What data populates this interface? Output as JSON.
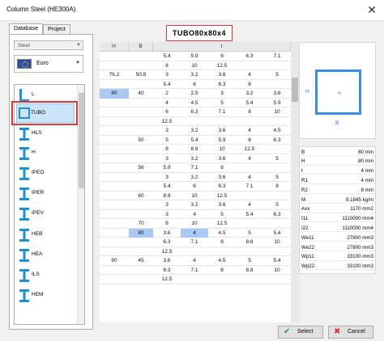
{
  "window": {
    "title": "Column Steel (HE300A)"
  },
  "tabs": [
    "Database",
    "Project"
  ],
  "material_combo": "Steel",
  "standard_combo": "Euro",
  "sections": [
    {
      "label": "L",
      "icon": "angle-section-icon"
    },
    {
      "label": "TUBO",
      "icon": "square-tube-icon"
    },
    {
      "label": "HLS",
      "icon": "i-beam-icon"
    },
    {
      "label": "H",
      "icon": "i-beam-icon"
    },
    {
      "label": "IPEO",
      "icon": "i-beam-icon"
    },
    {
      "label": "IPER",
      "icon": "i-beam-icon"
    },
    {
      "label": "IPEV",
      "icon": "i-beam-icon"
    },
    {
      "label": "HEB",
      "icon": "i-beam-icon"
    },
    {
      "label": "HEA",
      "icon": "i-beam-icon"
    },
    {
      "label": "ILS",
      "icon": "i-beam-icon"
    },
    {
      "label": "HEM",
      "icon": "i-beam-icon"
    }
  ],
  "selected_section": "TUBO",
  "profile_name": "TUBO80x80x4",
  "grid": {
    "columns": [
      "H",
      "B",
      "t"
    ],
    "h_col": [
      "",
      "",
      "76.2",
      "",
      "80",
      "",
      "",
      "",
      "",
      "",
      "",
      "",
      "",
      "",
      "",
      "",
      "",
      "",
      "",
      "",
      "",
      "",
      "90",
      "",
      ""
    ],
    "b_col": [
      "",
      "",
      "50.8",
      "",
      "40",
      "",
      "",
      "",
      "",
      "50",
      "",
      "",
      "56",
      "",
      "",
      "60",
      "",
      "",
      "70",
      "80",
      "",
      "",
      "45",
      "",
      ""
    ],
    "t_col": [
      [
        "5.4",
        "5.9",
        "6",
        "6.3",
        "7.1"
      ],
      [
        "8",
        "10",
        "12.5",
        "",
        ""
      ],
      [
        "3",
        "3.2",
        "3.6",
        "4",
        "5"
      ],
      [
        "5.4",
        "6",
        "6.3",
        "8",
        ""
      ],
      [
        "2",
        "2.5",
        "3",
        "3.2",
        "3.6"
      ],
      [
        "4",
        "4.5",
        "5",
        "5.4",
        "5.9"
      ],
      [
        "6",
        "6.3",
        "7.1",
        "8",
        "10"
      ],
      [
        "12.5",
        "",
        "",
        "",
        ""
      ],
      [
        "3",
        "3.2",
        "3.6",
        "4",
        "4.5"
      ],
      [
        "5",
        "5.4",
        "5.9",
        "6",
        "6.3"
      ],
      [
        "8",
        "8.8",
        "10",
        "12.5",
        ""
      ],
      [
        "3",
        "3.2",
        "3.6",
        "4",
        "5"
      ],
      [
        "5.9",
        "7.1",
        "8",
        "",
        ""
      ],
      [
        "3",
        "3.2",
        "3.6",
        "4",
        "5"
      ],
      [
        "5.4",
        "6",
        "6.3",
        "7.1",
        "8"
      ],
      [
        "8.8",
        "10",
        "12.5",
        "",
        ""
      ],
      [
        "3",
        "3.2",
        "3.6",
        "4",
        "5"
      ],
      [
        "3",
        "4",
        "5",
        "5.4",
        "6.3"
      ],
      [
        "8",
        "10",
        "12.5",
        "",
        ""
      ],
      [
        "3.6",
        "4",
        "4.5",
        "5",
        "5.4"
      ],
      [
        "6.3",
        "7.1",
        "8",
        "8.8",
        "10"
      ],
      [
        "12.5",
        "",
        "",
        "",
        ""
      ],
      [
        "3.6",
        "4",
        "4.5",
        "5",
        "5.4"
      ],
      [
        "6.3",
        "7.1",
        "8",
        "8.8",
        "10"
      ],
      [
        "12.5",
        "",
        "",
        "",
        ""
      ]
    ]
  },
  "preview": {
    "h_label": "H",
    "b_label": "B"
  },
  "properties": [
    {
      "name": "B",
      "value": "80 mm"
    },
    {
      "name": "H",
      "value": "80 mm"
    },
    {
      "name": "t",
      "value": "4 mm"
    },
    {
      "name": "R1",
      "value": "4 mm"
    },
    {
      "name": "R2",
      "value": "8 mm"
    },
    {
      "name": "M",
      "value": "9.1845 kg/m"
    },
    {
      "name": "Axx",
      "value": "1170 mm2"
    },
    {
      "name": "I11",
      "value": "1110000 mm4"
    },
    {
      "name": "I22",
      "value": "1110000 mm4"
    },
    {
      "name": "We11",
      "value": "27800 mm3"
    },
    {
      "name": "We22",
      "value": "27800 mm3"
    },
    {
      "name": "Wp11",
      "value": "33100 mm3"
    },
    {
      "name": "Wp22",
      "value": "33100 mm3"
    }
  ],
  "buttons": {
    "select": "Select",
    "cancel": "Cancel"
  },
  "colors": {
    "highlight_red": "#d9363e",
    "selection_blue": "#a9c8f3",
    "shape_blue": "#3a8ee6"
  }
}
